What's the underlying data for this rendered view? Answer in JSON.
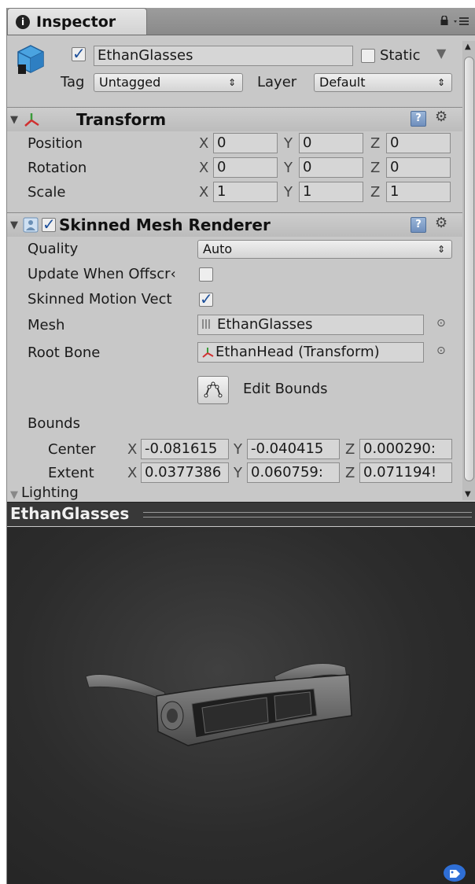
{
  "tab": {
    "title": "Inspector"
  },
  "object": {
    "name": "EthanGlasses",
    "static_label": "Static",
    "tag_label": "Tag",
    "tag_value": "Untagged",
    "layer_label": "Layer",
    "layer_value": "Default"
  },
  "transform": {
    "title": "Transform",
    "rows": [
      {
        "label": "Position",
        "x": "0",
        "y": "0",
        "z": "0"
      },
      {
        "label": "Rotation",
        "x": "0",
        "y": "0",
        "z": "0"
      },
      {
        "label": "Scale",
        "x": "1",
        "y": "1",
        "z": "1"
      }
    ]
  },
  "axes": {
    "x": "X",
    "y": "Y",
    "z": "Z"
  },
  "smr": {
    "title": "Skinned Mesh Renderer",
    "quality_label": "Quality",
    "quality_value": "Auto",
    "update_offscreen_label": "Update When Offscr‹",
    "motion_vectors_label": "Skinned Motion Vect",
    "mesh_label": "Mesh",
    "mesh_value": "EthanGlasses",
    "root_bone_label": "Root Bone",
    "root_bone_value": "EthanHead (Transform)",
    "edit_bounds_label": "Edit Bounds",
    "bounds_label": "Bounds",
    "center_label": "Center",
    "center": {
      "x": "-0.081615",
      "y": "-0.040415",
      "z": "0.000290:"
    },
    "extent_label": "Extent",
    "extent": {
      "x": "0.0377386",
      "y": "0.060759:",
      "z": "0.071194!"
    },
    "lighting_label": "Lighting"
  },
  "preview": {
    "title": "EthanGlasses"
  }
}
